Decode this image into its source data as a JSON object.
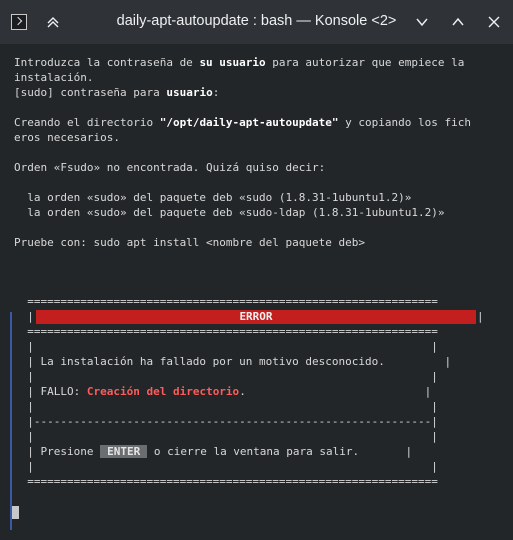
{
  "window": {
    "title": "daily-apt-autoupdate : bash — Konsole <2>"
  },
  "titlebar_icons": [
    "terminal-app-icon",
    "keep-above-icon",
    "chevron-down-icon",
    "maximize-icon",
    "close-icon"
  ],
  "terminal": {
    "l1a": "Introduzca la contraseña de ",
    "l1b": "su usuario",
    "l1c": " para autorizar que empiece la",
    "l2": "instalación.",
    "l3a": "[sudo] contraseña para ",
    "l3b": "usuario",
    "l3c": ":",
    "l4a": "Creando el directorio ",
    "l4b": "\"/opt/daily-apt-autoupdate\"",
    "l4c": " y copiando los fich",
    "l5": "eros necesarios.",
    "l6": "Orden «Fsudo» no encontrada. Quizá quiso decir:",
    "l7": "  la orden «sudo» del paquete deb «sudo (1.8.31-1ubuntu1.2)»",
    "l8": "  la orden «sudo» del paquete deb «sudo-ldap (1.8.31-1ubuntu1.2)»",
    "l9": "Pruebe con: sudo apt install <nombre del paquete deb>",
    "box_top": "  ==============================================================",
    "box_bar_left": "  |",
    "box_bar_right": "|",
    "error_label": "ERROR",
    "box_sep": "  ==============================================================",
    "box_empty": "  |                                                            |",
    "msg": "  | La instalación ha fallado por un motivo desconocido.         |",
    "fail_prefix": "  | FALLO: ",
    "fail_text": "Creación del directorio",
    "fail_suffix": ".                           |",
    "dash": "  |------------------------------------------------------------|",
    "press_prefix": "  | Presione ",
    "enter_label": "ENTER",
    "press_suffix": " o cierre la ventana para salir.       |",
    "box_bottom": "  =============================================================="
  }
}
